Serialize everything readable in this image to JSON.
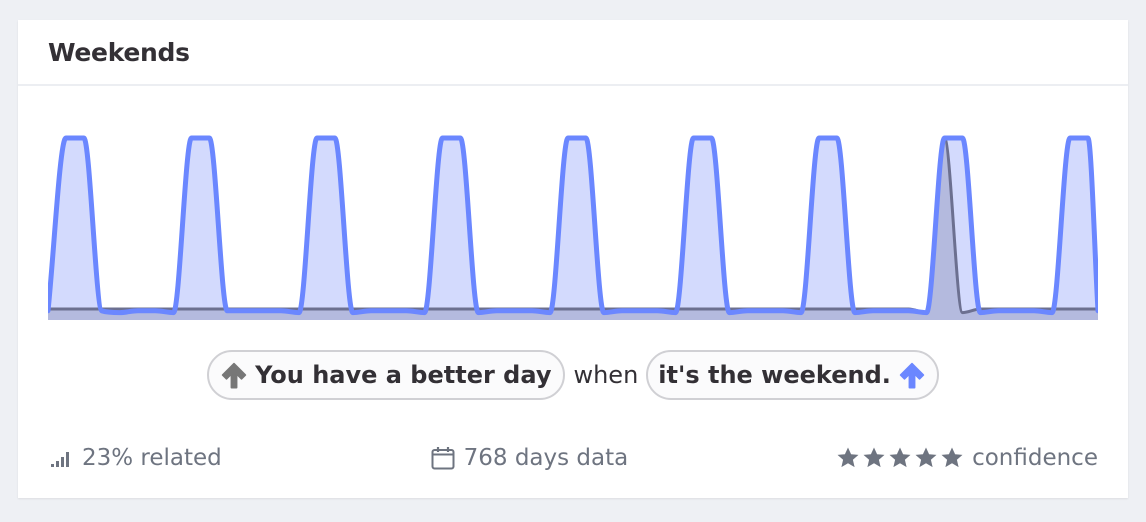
{
  "card": {
    "title": "Weekends"
  },
  "sentence": {
    "left_pill": {
      "icon": "arrow-up-icon",
      "icon_color": "#777777",
      "label": "You have a better day"
    },
    "connector": "when",
    "right_pill": {
      "icon": "arrow-up-icon",
      "icon_color": "#6b87ff",
      "label": "it's the weekend."
    }
  },
  "footer": {
    "related": {
      "icon": "signal-bars-icon",
      "label": "23% related"
    },
    "days": {
      "icon": "calendar-icon",
      "label": "768 days data"
    },
    "confidence": {
      "icon": "star-icon",
      "stars": 5,
      "max_stars": 5,
      "label": "confidence"
    }
  },
  "colors": {
    "accent": "#6b87ff",
    "accent_fill": "#d3dafd",
    "secondary_line": "#6c7090",
    "secondary_fill": "#b4bade",
    "muted_text": "#6e7480"
  },
  "chart_data": {
    "type": "area",
    "title": "",
    "xlabel": "",
    "ylabel": "",
    "ylim": [
      0,
      1
    ],
    "grid": false,
    "legend": "none",
    "x_unit": "day",
    "series": [
      {
        "name": "weekend",
        "color": "#6b87ff",
        "values": [
          0.04,
          1,
          1,
          0.04,
          0.03,
          0.04,
          0.04,
          0.03,
          1,
          1,
          0.04,
          0.04,
          0.04,
          0.04,
          0.03,
          1,
          1,
          0.03,
          0.04,
          0.04,
          0.04,
          0.03,
          1,
          1,
          0.03,
          0.04,
          0.04,
          0.04,
          0.03,
          1,
          1,
          0.03,
          0.04,
          0.04,
          0.04,
          0.03,
          1,
          1,
          0.03,
          0.04,
          0.04,
          0.04,
          0.03,
          1,
          1,
          0.03,
          0.04,
          0.04,
          0.04,
          0.03,
          1,
          1,
          0.03,
          0.04,
          0.04,
          0.04,
          0.03,
          1,
          1,
          0.04
        ]
      },
      {
        "name": "mood",
        "color": "#6c7090",
        "values": [
          0.05,
          0.05,
          0.05,
          0.05,
          0.05,
          0.05,
          0.05,
          0.05,
          0.05,
          0.05,
          0.05,
          0.05,
          0.05,
          0.05,
          0.05,
          0.05,
          0.05,
          0.05,
          0.05,
          0.05,
          0.05,
          0.05,
          0.05,
          0.05,
          0.05,
          0.05,
          0.05,
          0.05,
          0.05,
          0.05,
          0.05,
          0.05,
          0.05,
          0.05,
          0.05,
          0.05,
          0.05,
          0.05,
          0.05,
          0.05,
          0.05,
          0.05,
          0.05,
          0.05,
          0.05,
          0.05,
          0.05,
          0.05,
          0.05,
          0.03,
          1,
          0.03,
          0.05,
          0.05,
          0.05,
          0.05,
          0.05,
          0.05,
          0.05,
          0.05
        ]
      }
    ]
  }
}
